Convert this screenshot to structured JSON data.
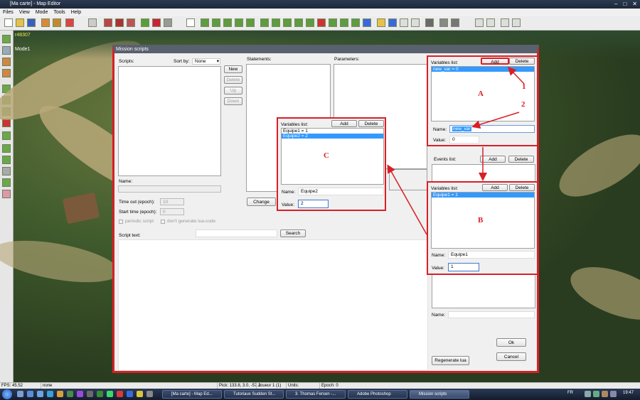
{
  "window": {
    "title": "[Ma carte] - Map Editor"
  },
  "menu": [
    "Files",
    "View",
    "Mode",
    "Tools",
    "Help"
  ],
  "viewport": {
    "id_text": "r48307",
    "mode_text": "Mode1"
  },
  "dialog": {
    "title": "Mission scripts",
    "scripts_label": "Scripts:",
    "sortby_label": "Sort by:",
    "sortby_value": "None",
    "buttons": {
      "new": "New",
      "delete": "Delete",
      "up": "Up",
      "down": "Down"
    },
    "statements_label": "Statements:",
    "parameters_label": "Parameters:",
    "name_label": "Name:",
    "timeout_label": "Time out (epoch):",
    "timeout_value": "10",
    "starttime_label": "Start time (epoch):",
    "starttime_value": "0",
    "periodic_label": "periodic script",
    "nolua_label": "don't generate lua-code",
    "change_label": "Change",
    "scripttext_label": "Script text:",
    "search_label": "Search",
    "events_label": "Events list:",
    "events_add": "Add",
    "events_delete": "Delete",
    "lower_name_label": "Name:",
    "ok_label": "Ok",
    "cancel_label": "Cancel",
    "regenerate_label": "Regenerate lua"
  },
  "panelA": {
    "title": "Variables list:",
    "add": "Add",
    "delete": "Delete",
    "items": [
      "new_var = 0"
    ],
    "name_label": "Name:",
    "name_value": "new_var",
    "value_label": "Value:",
    "value_value": "0",
    "letter": "A"
  },
  "panelB": {
    "title": "Variables list:",
    "add": "Add",
    "delete": "Delete",
    "items": [
      "Equipe1 = 1"
    ],
    "name_label": "Name:",
    "name_value": "Equipe1",
    "value_label": "Value:",
    "value_value": "1",
    "letter": "B"
  },
  "panelC": {
    "title": "Variables list:",
    "add": "Add",
    "delete": "Delete",
    "items": [
      "Equipe1 = 1",
      "Equipe2 = 2"
    ],
    "name_label": "Name:",
    "name_value": "Equipe2",
    "value_label": "Value:",
    "value_value": "2",
    "letter": "C"
  },
  "annotations": {
    "n1": "1",
    "n2": "2"
  },
  "statusbar": {
    "fps": "FPS: 45.52",
    "none": "none",
    "pick": "Pick: 133.8, 3.0, -57.1",
    "joueur": "Joueur 1 (1)",
    "units": "Units:",
    "epoch": "Epoch: 0"
  },
  "taskbar": {
    "items": [
      "[Ma carte] - Map Ed...",
      "Tutoriaux Sudden St...",
      "3. Thomas Fersen -...",
      "Adobe Photoshop",
      "Mission scripts"
    ],
    "lang": "FR",
    "clock": "19:47"
  },
  "colors": {
    "annotation": "#d91f26",
    "selection": "#3399ff"
  }
}
